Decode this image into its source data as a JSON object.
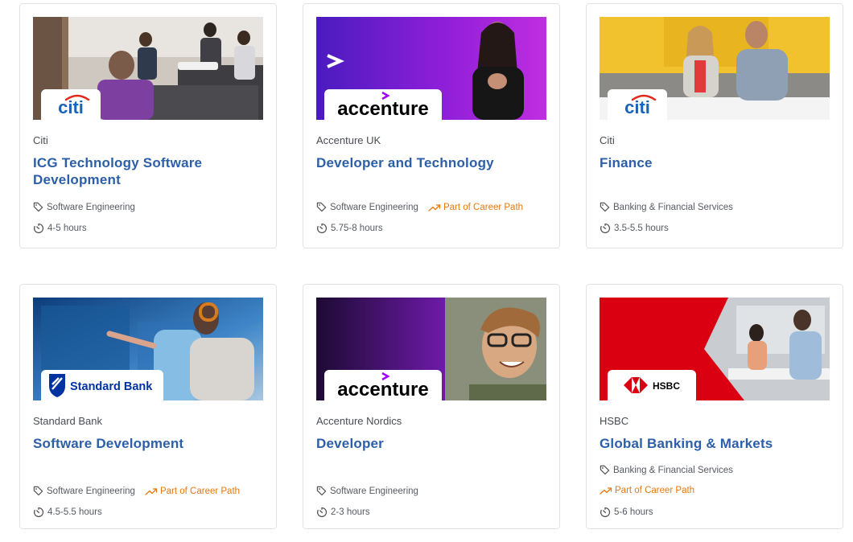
{
  "colors": {
    "title_blue": "#2c5fa8",
    "career_orange": "#e5780e",
    "citi_blue": "#1a63b6",
    "citi_red": "#e1251b",
    "accenture_purple": "#a100ff",
    "hsbc_red": "#db0011",
    "standard_bank_blue": "#0033a1"
  },
  "cards": [
    {
      "company": "Citi",
      "title": "ICG Technology Software Development",
      "tag": "Software Engineering",
      "career_path": "",
      "duration": "4-5 hours",
      "logo_text": "citi"
    },
    {
      "company": "Accenture UK",
      "title": "Developer and Technology",
      "tag": "Software Engineering",
      "career_path": "Part of Career Path",
      "duration": "5.75-8 hours",
      "logo_text": "accenture"
    },
    {
      "company": "Citi",
      "title": "Finance",
      "tag": "Banking & Financial Services",
      "career_path": "",
      "duration": "3.5-5.5 hours",
      "logo_text": "citi"
    },
    {
      "company": "Standard Bank",
      "title": "Software Development",
      "tag": "Software Engineering",
      "career_path": "Part of Career Path",
      "duration": "4.5-5.5 hours",
      "logo_text": "Standard Bank"
    },
    {
      "company": "Accenture Nordics",
      "title": "Developer",
      "tag": "Software Engineering",
      "career_path": "",
      "duration": "2-3 hours",
      "logo_text": "accenture"
    },
    {
      "company": "HSBC",
      "title": "Global Banking & Markets",
      "tag": "Banking & Financial Services",
      "career_path": "Part of Career Path",
      "duration": "5-6 hours",
      "logo_text": "HSBC"
    }
  ],
  "icons": {
    "tag": "tag-icon",
    "career": "trending-up-icon",
    "duration": "timer-icon"
  }
}
